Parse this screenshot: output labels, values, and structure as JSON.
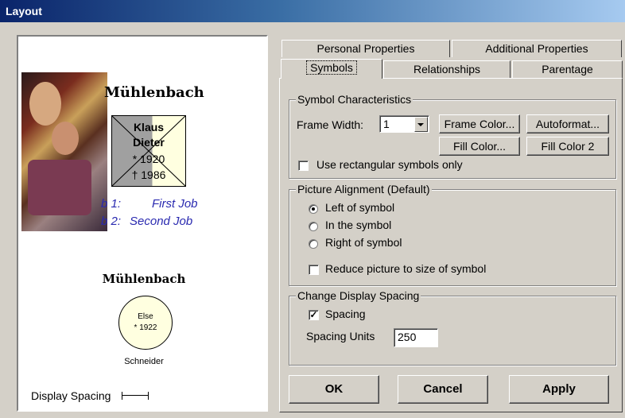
{
  "window": {
    "title": "Layout"
  },
  "preview": {
    "top_name": "Mühlenbach",
    "symbol": {
      "first_name": "Klaus",
      "second_name": "Dieter",
      "born": "* 1920",
      "died": "† 1986"
    },
    "jobs": [
      {
        "num": "b 1:",
        "title": "First Job"
      },
      {
        "num": "b 2:",
        "title": "Second Job"
      }
    ],
    "bottom_name": "Mühlenbach",
    "circle": {
      "first_name": "Else",
      "born": "* 1922"
    },
    "surname": "Schneider",
    "display_spacing_label": "Display Spacing"
  },
  "tabs": {
    "row1": [
      "Personal Properties",
      "Additional Properties"
    ],
    "row2": [
      "Symbols",
      "Relationships",
      "Parentage"
    ],
    "active": "Symbols"
  },
  "symbol_characteristics": {
    "title": "Symbol Characteristics",
    "frame_width_label": "Frame Width:",
    "frame_width_value": "1",
    "frame_color_button": "Frame Color...",
    "autoformat_button": "Autoformat...",
    "fill_color_button": "Fill Color...",
    "fill_color2_button": "Fill Color 2",
    "rect_only_label": "Use rectangular symbols only",
    "rect_only_checked": false
  },
  "picture_alignment": {
    "title": "Picture Alignment (Default)",
    "options": [
      "Left of symbol",
      "In the symbol",
      "Right of symbol"
    ],
    "selected": "Left of symbol",
    "reduce_label": "Reduce picture to size of symbol",
    "reduce_checked": false
  },
  "display_spacing": {
    "title": "Change Display Spacing",
    "spacing_label": "Spacing",
    "spacing_checked": true,
    "spacing_units_label": "Spacing Units",
    "spacing_units_value": "250"
  },
  "buttons": {
    "ok": "OK",
    "cancel": "Cancel",
    "apply": "Apply"
  }
}
